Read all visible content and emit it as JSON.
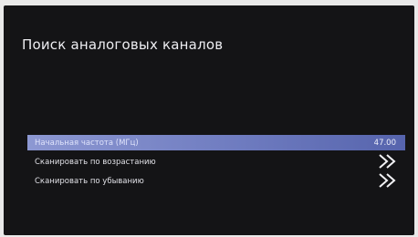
{
  "screen": {
    "title": "Поиск аналоговых каналов"
  },
  "menu": {
    "items": [
      {
        "label": "Начальная частота (МГц)",
        "value": "47.00",
        "selected": true
      },
      {
        "label": "Сканировать по возрастанию",
        "icon": "double-chevron-right-icon"
      },
      {
        "label": "Сканировать по убыванию",
        "icon": "double-chevron-right-icon"
      }
    ]
  },
  "colors": {
    "background": "#141416",
    "highlight": "#7b87c8",
    "text": "#e6e6ea"
  }
}
